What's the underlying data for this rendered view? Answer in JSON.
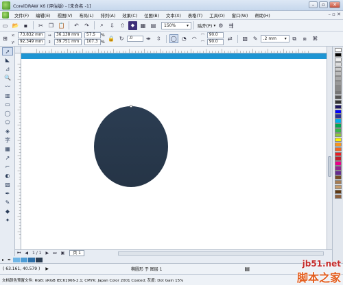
{
  "window": {
    "title": "CorelDRAW X6 (评估版) - [未命名 -1]"
  },
  "menu": [
    "文件(F)",
    "编辑(E)",
    "视图(V)",
    "布局(L)",
    "排列(A)",
    "效果(C)",
    "位图(B)",
    "文本(X)",
    "表格(T)",
    "工具(O)",
    "窗口(W)",
    "帮助(H)"
  ],
  "standard_toolbar": {
    "zoom": "150%",
    "snap_label": "贴齐(P)",
    "outline_width": ".2 mm"
  },
  "properties": {
    "x_label": "x:",
    "x_value": "73.832 mm",
    "y_label": "y:",
    "y_value": "92.349 mm",
    "width_value": "36.138 mm",
    "height_value": "39.751 mm",
    "scale_x": "57.5",
    "scale_y": "107.3",
    "pct": "%",
    "rotation": ".0",
    "angle_start": "90.0",
    "angle_end": "90.0"
  },
  "page_nav": {
    "page_count": "1 / 1",
    "page_tab": "页 1"
  },
  "status": {
    "coords": "( 63.161, 40.579 )",
    "object_info": "椭圆形 于 图层 1",
    "color_profile": "文档颜色预置文件: RGB: sRGB IEC61966-2.1; CMYK: Japan Color 2001 Coated; 灰度: Dot Gain 15%"
  },
  "watermark": {
    "line1": "jb51.net",
    "line2": "脚本之家"
  },
  "colors": {
    "page_band": "#1e95d3",
    "ellipse_top": "#2b3d52",
    "ellipse_bottom": "#253446",
    "palette": [
      "#ffffff",
      "#000000",
      "#eeeeee",
      "#dddddd",
      "#cccccc",
      "#bbbbbb",
      "#aaaaaa",
      "#999999",
      "#888888",
      "#777777",
      "#555555",
      "#333333",
      "#1b1464",
      "#0000ff",
      "#2e3192",
      "#00aeef",
      "#00a651",
      "#39b54a",
      "#8dc63f",
      "#fff200",
      "#f7941d",
      "#f26522",
      "#ed1c24",
      "#be1e2d",
      "#ec008c",
      "#92278f",
      "#662d91",
      "#754c24",
      "#a67c52",
      "#c69c6d",
      "#603913",
      "#8b5e3c"
    ],
    "document_swatches": [
      "#6fb6e6",
      "#4e9dd6",
      "#2d6fa8",
      "#2b3d52"
    ]
  }
}
